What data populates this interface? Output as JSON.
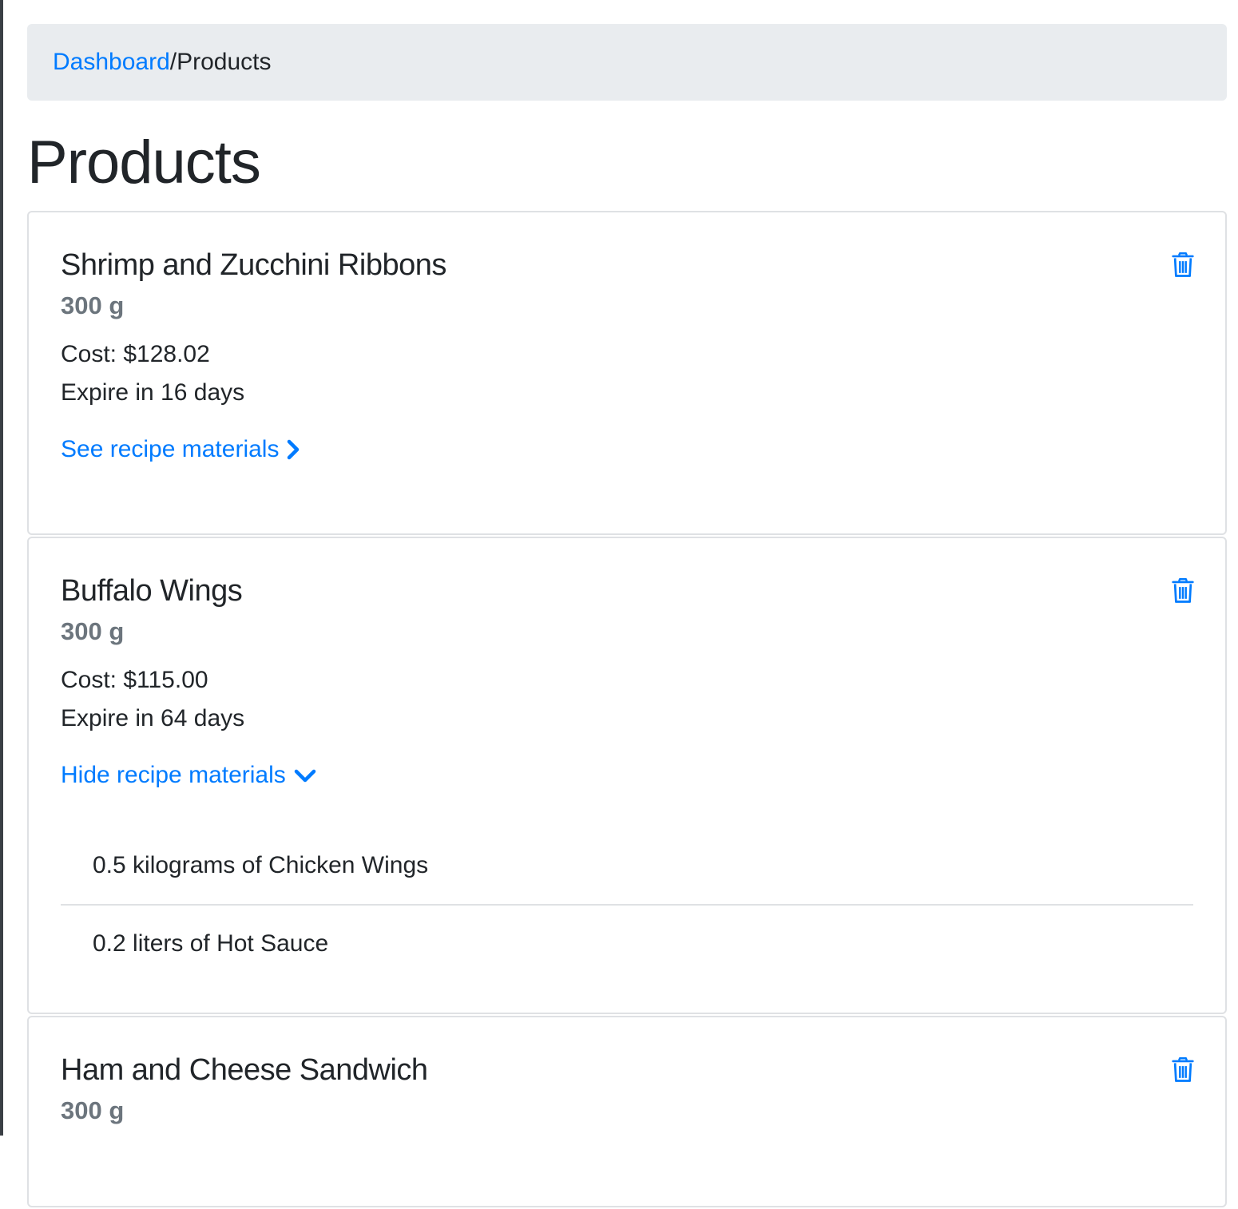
{
  "breadcrumb": {
    "link_label": "Dashboard",
    "separator": "/",
    "current": "Products"
  },
  "page": {
    "title": "Products"
  },
  "products": [
    {
      "name": "Shrimp and Zucchini Ribbons",
      "weight": "300 g",
      "cost": "Cost: $128.02",
      "expire": "Expire in 16 days",
      "toggle_label": "See recipe materials",
      "toggle_icon": "chevron-right-icon",
      "expanded": false,
      "materials": []
    },
    {
      "name": "Buffalo Wings",
      "weight": "300 g",
      "cost": "Cost: $115.00",
      "expire": "Expire in 64 days",
      "toggle_label": "Hide recipe materials",
      "toggle_icon": "chevron-down-icon",
      "expanded": true,
      "materials": [
        "0.5 kilograms of Chicken Wings",
        "0.2 liters of Hot Sauce"
      ]
    },
    {
      "name": "Ham and Cheese Sandwich",
      "weight": "300 g"
    }
  ],
  "colors": {
    "link": "#007bff",
    "muted": "#6c757d",
    "breadcrumb_bg": "#e9ecef",
    "border": "#dfe1e4"
  }
}
